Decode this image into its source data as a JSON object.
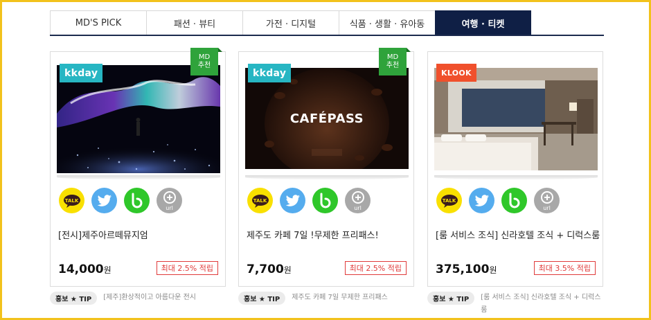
{
  "tabs": [
    {
      "label": "MD'S PICK"
    },
    {
      "label": "패션 · 뷰티"
    },
    {
      "label": "가전 · 디지털"
    },
    {
      "label": "식품 · 생활 · 유아동"
    },
    {
      "label": "여행 · 티켓",
      "active": true
    }
  ],
  "md_badge": {
    "line1": "MD",
    "line2": "추천"
  },
  "share_icons": [
    "kakaotalk-icon",
    "twitter-icon",
    "band-icon",
    "url-icon"
  ],
  "share_labels": {
    "kakao": "TALK",
    "url": "url"
  },
  "cards": [
    {
      "brand": "kkday",
      "md_pick": true,
      "title": "[전시]제주아르떼뮤지엄",
      "price": "14,000",
      "price_unit": "원",
      "reward": "최대 2.5% 적립",
      "tip_label": "홍보 ★ TIP",
      "tip_text": "[제주]환상적이고 아름다운 전시"
    },
    {
      "brand": "kkday",
      "md_pick": true,
      "image_text": "CAFÉPASS",
      "title": "제주도 카페 7일 !무제한 프리패스!",
      "price": "7,700",
      "price_unit": "원",
      "reward": "최대 2.5% 적립",
      "tip_label": "홍보 ★ TIP",
      "tip_text": "제주도 카페 7일 무제한 프리패스"
    },
    {
      "brand": "KLOOK",
      "md_pick": false,
      "title": "[룸 서비스 조식] 신라호텔 조식 + 디럭스룸",
      "price": "375,100",
      "price_unit": "원",
      "reward": "최대 3.5% 적립",
      "tip_label": "홍보 ★ TIP",
      "tip_text": "[룸 서비스 조식] 신라호텔 조식 + 디럭스룸"
    }
  ],
  "colors": {
    "accent": "#0f1f45",
    "reward": "#e03a3a",
    "frame": "#f2c21b",
    "md_badge": "#2fa33b"
  }
}
